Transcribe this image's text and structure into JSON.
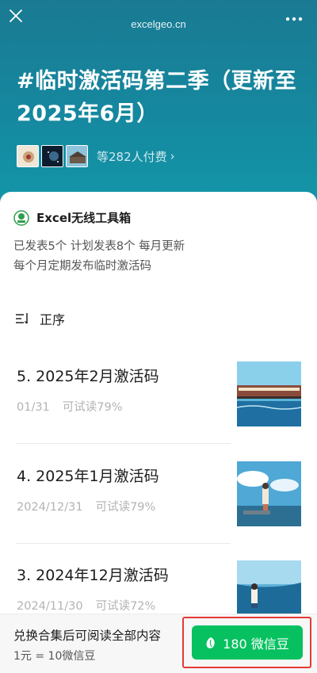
{
  "header": {
    "domain": "excelgeo.cn",
    "close_icon": "close-icon",
    "more_icon": "more-dots-icon"
  },
  "album": {
    "title": "#临时激活码第二季（更新至2025年6月）",
    "payers_text": "等282人付费",
    "payers_chevron": "›"
  },
  "account": {
    "name": "Excel无线工具箱",
    "desc_line1": "已发表5个 计划发表8个 每月更新",
    "desc_line2": "每个月定期发布临时激活码"
  },
  "sort": {
    "label": "正序",
    "icon": "sort-order-icon"
  },
  "articles": [
    {
      "title": "5. 2025年2月激活码",
      "date": "01/31",
      "trial": "可试读79%"
    },
    {
      "title": "4. 2025年1月激活码",
      "date": "2024/12/31",
      "trial": "可试读79%"
    },
    {
      "title": "3. 2024年12月激活码",
      "date": "2024/11/30",
      "trial": "可试读72%"
    }
  ],
  "purchase": {
    "main_text": "兑换合集后可阅读全部内容",
    "rate_text": "1元 = 10微信豆",
    "button_label": "180 微信豆"
  },
  "colors": {
    "header_bg": "#1a7a93",
    "button_green": "#07c160",
    "highlight_red": "#e53935"
  }
}
